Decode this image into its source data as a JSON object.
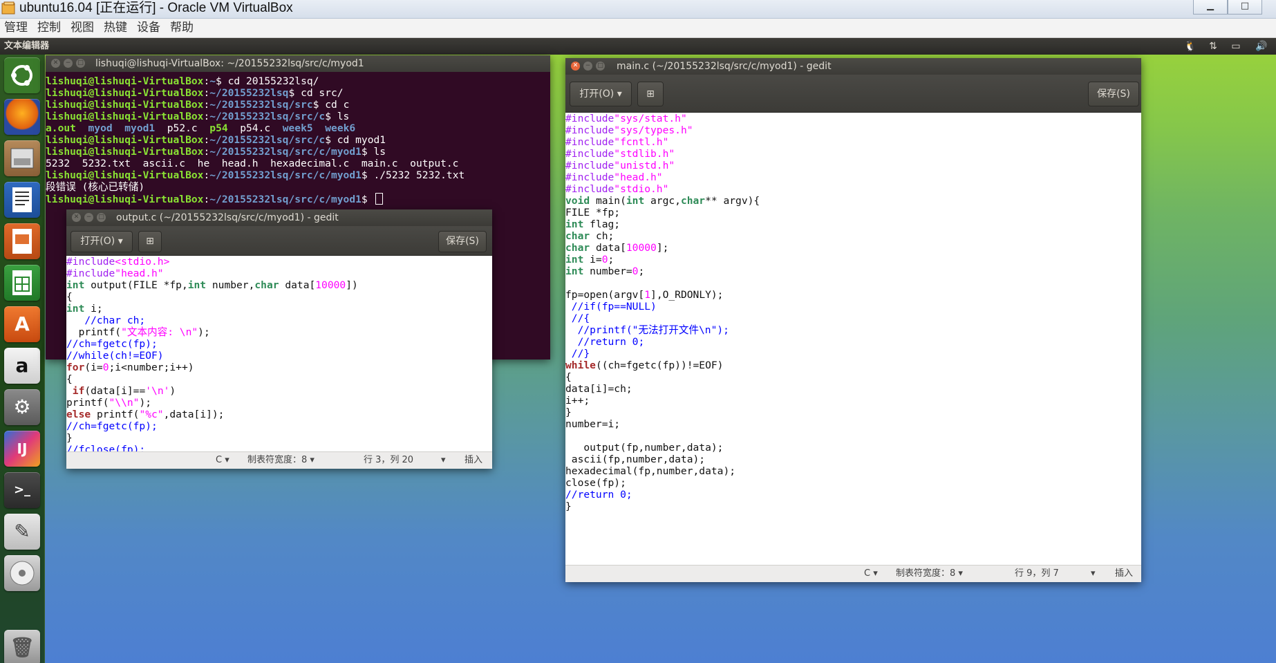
{
  "vbox": {
    "title": "ubuntu16.04 [正在运行] - Oracle VM VirtualBox",
    "menu": [
      "管理",
      "控制",
      "视图",
      "热键",
      "设备",
      "帮助"
    ],
    "minimize": "▁",
    "maximize": "□"
  },
  "panel": {
    "app_title": "文本编辑器"
  },
  "launcher": {
    "items": [
      "ubuntu-dash",
      "firefox",
      "file-manager",
      "libreoffice-writer",
      "libreoffice-impress",
      "libreoffice-calc",
      "software-center",
      "amazon",
      "system-settings",
      "intellij-idea",
      "terminal",
      "text-editor",
      "dvd",
      "trash"
    ]
  },
  "terminal": {
    "title": "lishuqi@lishuqi-VirtualBox: ~/20155232lsq/src/c/myod1",
    "prompt_user": "lishuqi@lishuqi-VirtualBox",
    "lines": [
      {
        "path": "~",
        "cmd": " cd 20155232lsq/"
      },
      {
        "path": "~/20155232lsq",
        "cmd": " cd src/"
      },
      {
        "path": "~/20155232lsq/src",
        "cmd": " cd c"
      },
      {
        "path": "~/20155232lsq/src/c",
        "cmd": " ls"
      }
    ],
    "ls1": [
      "a.out",
      "myod",
      "myod1",
      "p52.c",
      "p54",
      "p54.c",
      "week5",
      "week6"
    ],
    "lines2": [
      {
        "path": "~/20155232lsq/src/c",
        "cmd": " cd myod1"
      },
      {
        "path": "~/20155232lsq/src/c/myod1",
        "cmd": " ls"
      }
    ],
    "ls2": "5232  5232.txt  ascii.c  he  head.h  hexadecimal.c  main.c  output.c",
    "line3": {
      "path": "~/20155232lsq/src/c/myod1",
      "cmd": " ./5232 5232.txt"
    },
    "error": "段错误 (核心已转储)",
    "line4": {
      "path": "~/20155232lsq/src/c/myod1",
      "cmd": " "
    }
  },
  "gedit_output": {
    "title": "output.c (~/20155232lsq/src/c/myod1) - gedit",
    "open_label": "打开(O)",
    "save_label": "保存(S)",
    "code": [
      "#include<stdio.h>",
      "#include\"head.h\"",
      "int output(FILE *fp,int number,char data[10000])",
      "{",
      "int i;",
      "   //char ch;",
      "  printf(\"文本内容: \\n\");",
      "//ch=fgetc(fp);",
      "//while(ch!=EOF)",
      "for(i=0;i<number;i++)",
      "{",
      " if(data[i]=='\\n')",
      "printf(\"\\\\n\");",
      "else printf(\"%c\",data[i]);",
      "//ch=fgetc(fp);",
      "}",
      "//fclose(fp);",
      "}"
    ],
    "status": {
      "lang": "C",
      "tab_width": "制表符宽度：8",
      "position": "行 3，列 20",
      "mode": "插入"
    }
  },
  "gedit_main": {
    "title": "main.c (~/20155232lsq/src/c/myod1) - gedit",
    "open_label": "打开(O)",
    "save_label": "保存(S)",
    "code": [
      "#include\"sys/stat.h\"",
      "#include\"sys/types.h\"",
      "#include\"fcntl.h\"",
      "#include\"stdlib.h\"",
      "#include\"unistd.h\"",
      "#include\"head.h\"",
      "#include\"stdio.h\"",
      "void main(int argc,char** argv){",
      "FILE *fp;",
      "int flag;",
      "char ch;",
      "char data[10000];",
      "int i=0;",
      "int number=0;",
      "",
      "fp=open(argv[1],O_RDONLY);",
      " //if(fp==NULL)",
      " //{",
      "  //printf(\"无法打开文件\\n\");",
      "  //return 0;",
      " //}",
      "while((ch=fgetc(fp))!=EOF)",
      "{",
      "data[i]=ch;",
      "i++;",
      "}",
      "number=i;",
      "",
      "   output(fp,number,data);",
      " ascii(fp,number,data);",
      "hexadecimal(fp,number,data);",
      "close(fp);",
      "//return 0;",
      "}"
    ],
    "status": {
      "lang": "C",
      "tab_width": "制表符宽度：8",
      "position": "行 9，列 7",
      "mode": "插入"
    }
  }
}
